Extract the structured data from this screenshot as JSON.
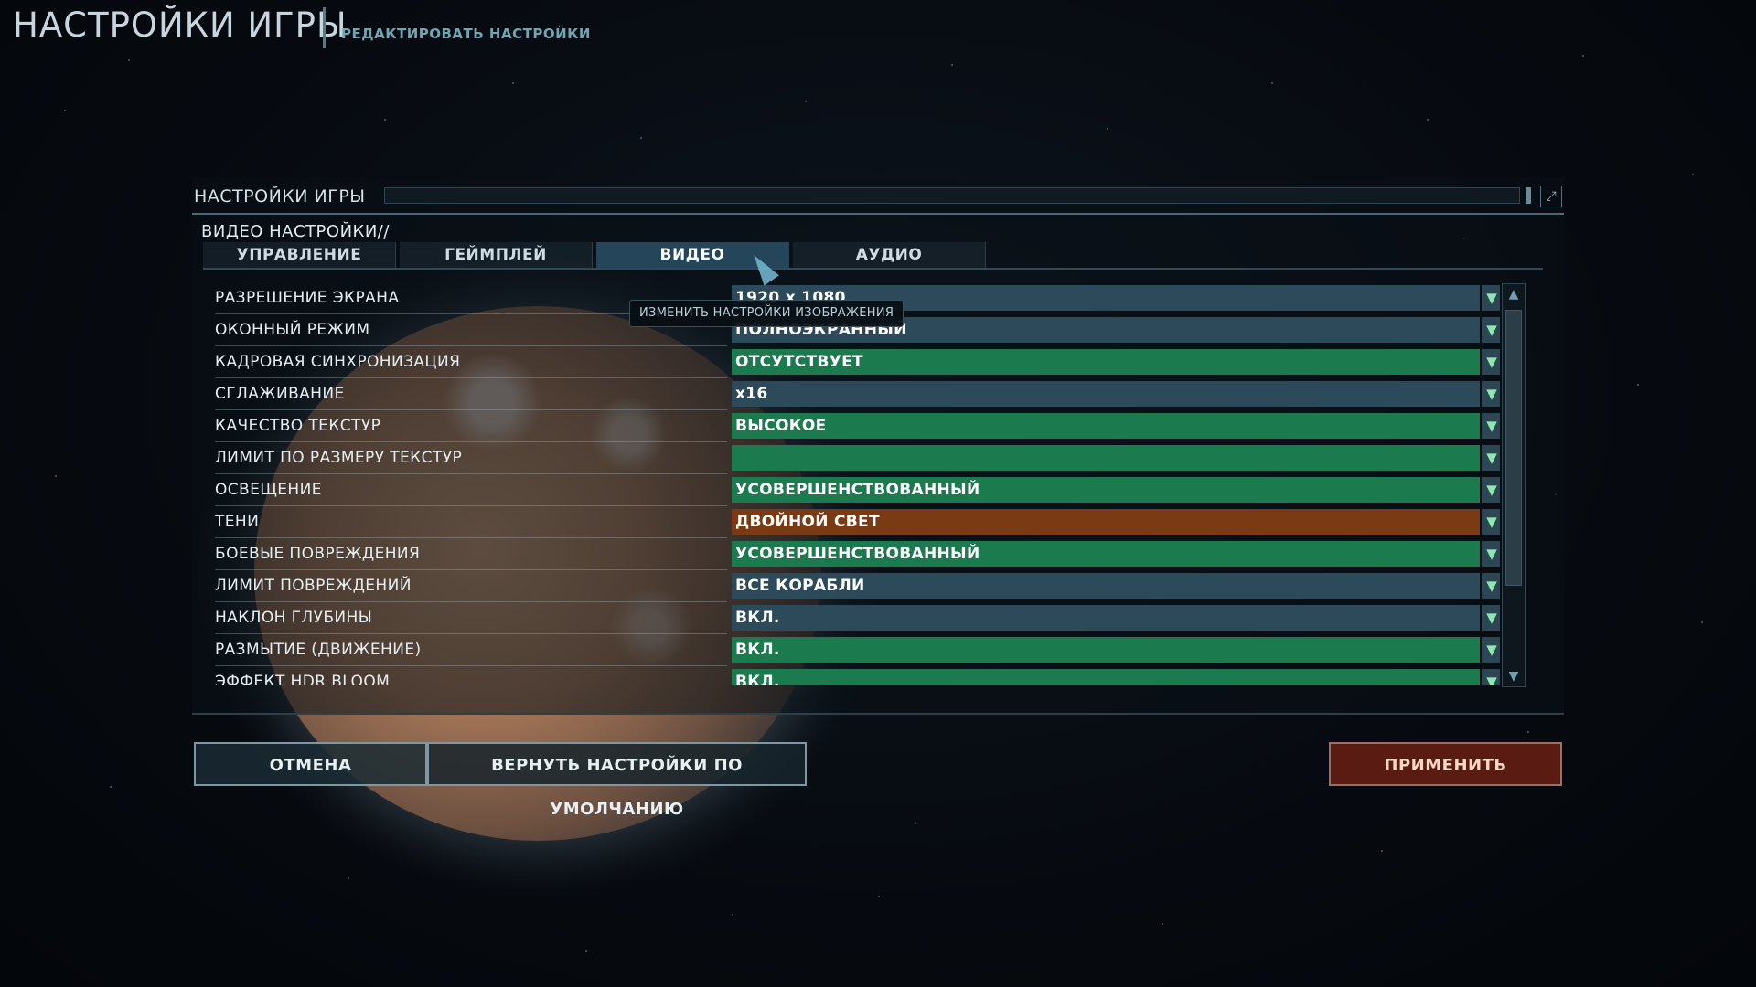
{
  "header": {
    "title": "НАСТРОЙКИ ИГРЫ",
    "subtitle": "РЕДАКТИРОВАТЬ НАСТРОЙКИ"
  },
  "dialog": {
    "title": "НАСТРОЙКИ ИГРЫ",
    "section_label": "ВИДЕО НАСТРОЙКИ//",
    "tabs": [
      {
        "label": "УПРАВЛЕНИЕ",
        "active": false
      },
      {
        "label": "ГЕЙМПЛЕЙ",
        "active": false
      },
      {
        "label": "ВИДЕО",
        "active": true
      },
      {
        "label": "АУДИО",
        "active": false
      }
    ],
    "tooltip": "ИЗМЕНИТЬ НАСТРОЙКИ ИЗОБРАЖЕНИЯ",
    "settings": [
      {
        "label": "РАЗРЕШЕНИЕ ЭКРАНА",
        "value": "1920 x 1080",
        "color": "#2d4a5a"
      },
      {
        "label": "ОКОННЫЙ РЕЖИМ",
        "value": "ПОЛНОЭКРАННЫЙ",
        "color": "#2d4a5a"
      },
      {
        "label": "КАДРОВАЯ СИНХРОНИЗАЦИЯ",
        "value": "ОТСУТСТВУЕТ",
        "color": "#1b7a4e"
      },
      {
        "label": "СГЛАЖИВАНИЕ",
        "value": "x16",
        "color": "#2d4a5a"
      },
      {
        "label": "КАЧЕСТВО ТЕКСТУР",
        "value": "ВЫСОКОЕ",
        "color": "#1b7a4e"
      },
      {
        "label": "ЛИМИТ ПО РАЗМЕРУ ТЕКСТУР",
        "value": "",
        "color": "#1b7a4e"
      },
      {
        "label": "ОСВЕЩЕНИЕ",
        "value": "УСОВЕРШЕНСТВОВАННЫЙ",
        "color": "#1b7a4e"
      },
      {
        "label": "ТЕНИ",
        "value": "ДВОЙНОЙ СВЕТ",
        "color": "#7a3a14"
      },
      {
        "label": "БОЕВЫЕ ПОВРЕЖДЕНИЯ",
        "value": "УСОВЕРШЕНСТВОВАННЫЙ",
        "color": "#1b7a4e"
      },
      {
        "label": "ЛИМИТ ПОВРЕЖДЕНИЙ",
        "value": "ВСЕ КОРАБЛИ",
        "color": "#2d4a5a"
      },
      {
        "label": "НАКЛОН ГЛУБИНЫ",
        "value": "ВКЛ.",
        "color": "#2d4a5a"
      },
      {
        "label": "РАЗМЫТИЕ (ДВИЖЕНИЕ)",
        "value": "ВКЛ.",
        "color": "#1b7a4e"
      },
      {
        "label": "ЭФФЕКТ HDR BLOOM",
        "value": "ВКЛ.",
        "color": "#1b7a4e"
      }
    ]
  },
  "buttons": {
    "cancel": "ОТМЕНА",
    "defaults": "ВЕРНУТЬ НАСТРОЙКИ ПО УМОЛЧАНИЮ",
    "apply": "ПРИМЕНИТЬ"
  },
  "icons": {
    "dropdown": "chevron-down-icon",
    "scroll_up": "scroll-up-icon",
    "scroll_down": "scroll-down-icon",
    "resize": "resize-icon"
  }
}
